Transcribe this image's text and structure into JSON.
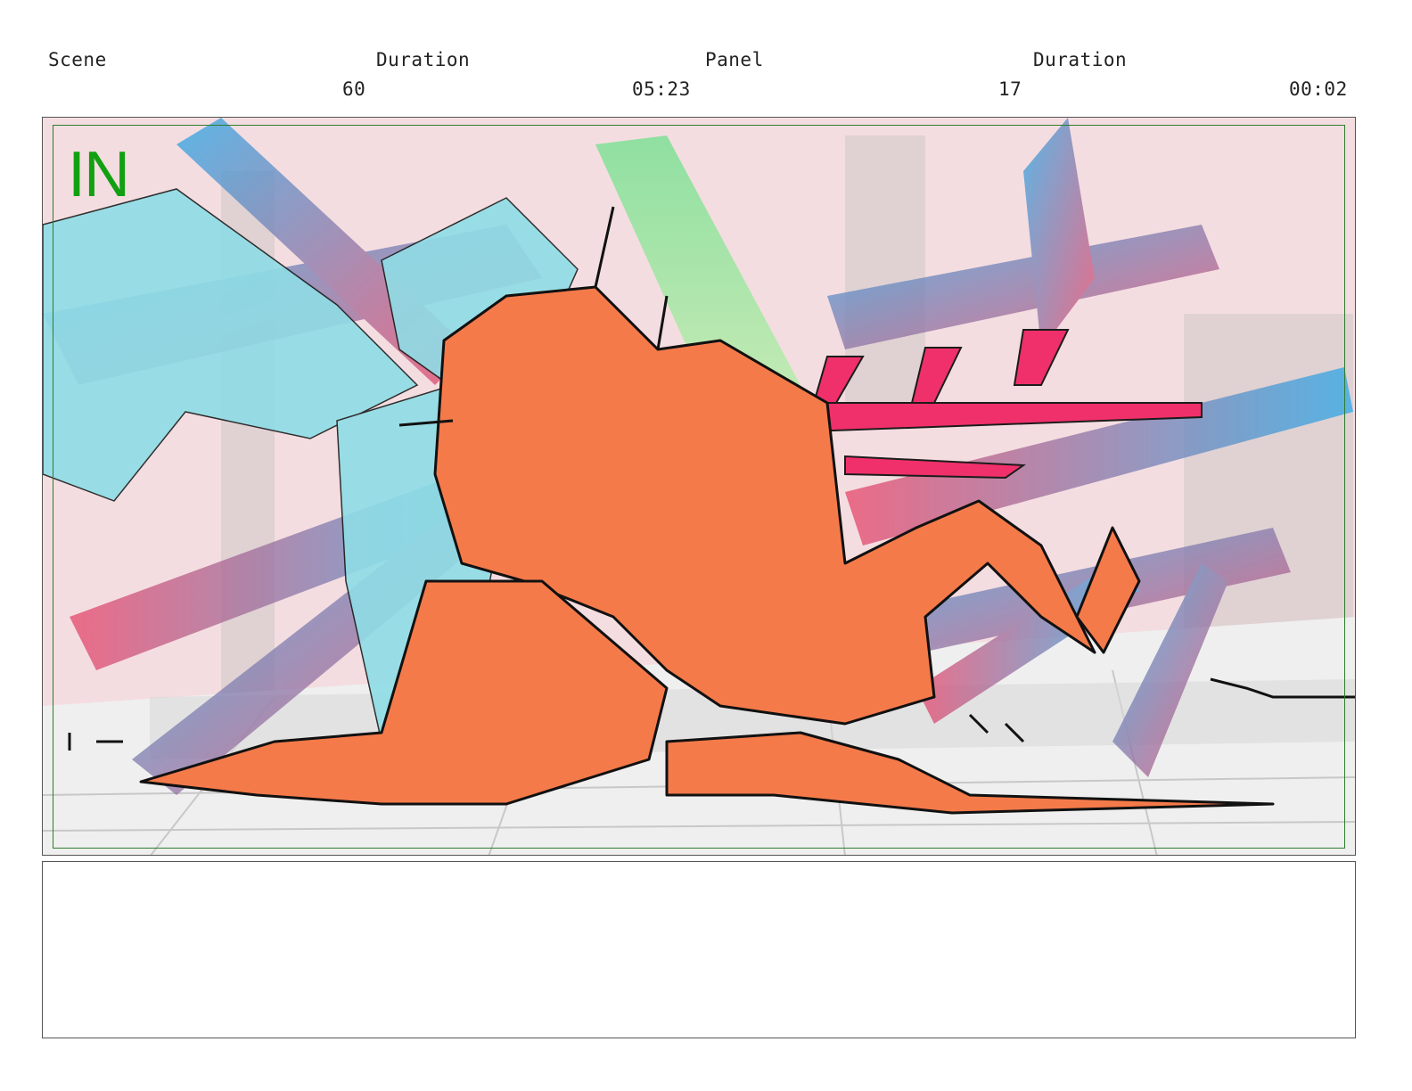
{
  "header": {
    "scene_label": "Scene",
    "scene_duration_label": "Duration",
    "panel_label": "Panel",
    "panel_duration_label": "Duration",
    "scene_number": "60",
    "scene_duration": "05:23",
    "panel_number": "17",
    "panel_duration": "00:02"
  },
  "panel": {
    "transition_label": "IN",
    "colors": {
      "background": "#f4dde0",
      "character_fill": "#f57a4a",
      "ghost_character": "#8fdde6",
      "weapon": "#f0306a",
      "safe_frame": "#2e7d2e",
      "label": "#12a012"
    }
  },
  "notes": {
    "text": ""
  }
}
